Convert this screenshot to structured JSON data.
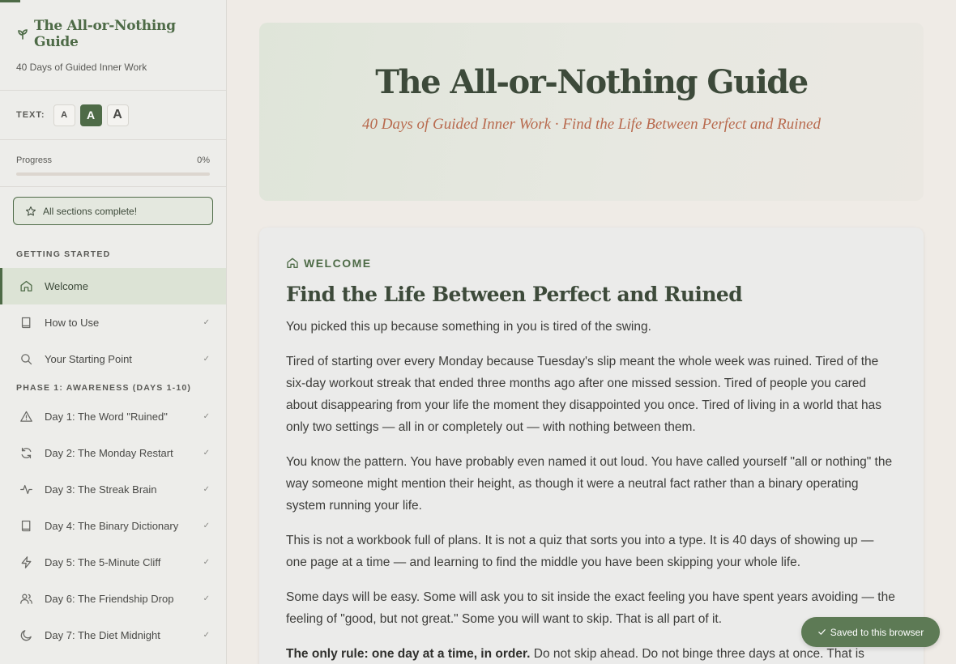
{
  "brand": {
    "title": "The All-or-Nothing Guide",
    "subtitle": "40 Days of Guided Inner Work"
  },
  "text_size": {
    "label": "TEXT:",
    "small": "A",
    "medium": "A",
    "large": "A",
    "selected": "medium"
  },
  "progress": {
    "label": "Progress",
    "value_text": "0%",
    "value": 0
  },
  "complete_badge": "All sections complete!",
  "nav": {
    "getting_started": {
      "title": "GETTING STARTED",
      "items": [
        {
          "label": "Welcome",
          "icon": "home-icon"
        },
        {
          "label": "How to Use",
          "icon": "book-icon",
          "check": "✓"
        },
        {
          "label": "Your Starting Point",
          "icon": "search-icon",
          "check": "✓"
        }
      ]
    },
    "phase1": {
      "title": "PHASE 1: AWARENESS (DAYS 1-10)",
      "items": [
        {
          "label": "Day 1: The Word \"Ruined\"",
          "icon": "warning-icon",
          "check": "✓"
        },
        {
          "label": "Day 2: The Monday Restart",
          "icon": "refresh-icon",
          "check": "✓"
        },
        {
          "label": "Day 3: The Streak Brain",
          "icon": "activity-icon",
          "check": "✓"
        },
        {
          "label": "Day 4: The Binary Dictionary",
          "icon": "book-icon",
          "check": "✓"
        },
        {
          "label": "Day 5: The 5-Minute Cliff",
          "icon": "lightning-icon",
          "check": "✓"
        },
        {
          "label": "Day 6: The Friendship Drop",
          "icon": "users-icon",
          "check": "✓"
        },
        {
          "label": "Day 7: The Diet Midnight",
          "icon": "moon-icon",
          "check": "✓"
        }
      ]
    }
  },
  "hero": {
    "title": "The All-or-Nothing Guide",
    "subtitle": "40 Days of Guided Inner Work · Find the Life Between Perfect and Ruined"
  },
  "card": {
    "eyebrow": "WELCOME",
    "title": "Find the Life Between Perfect and Ruined",
    "paragraphs": [
      "You picked this up because something in you is tired of the swing.",
      "Tired of starting over every Monday because Tuesday's slip meant the whole week was ruined. Tired of the six-day workout streak that ended three months ago after one missed session. Tired of people you cared about disappearing from your life the moment they disappointed you once. Tired of living in a world that has only two settings — all in or completely out — with nothing between them.",
      "You know the pattern. You have probably even named it out loud. You have called yourself \"all or nothing\" the way someone might mention their height, as though it were a neutral fact rather than a binary operating system running your life.",
      "This is not a workbook full of plans. It is not a quiz that sorts you into a type. It is 40 days of showing up — one page at a time — and learning to find the middle you have been skipping your whole life.",
      "Some days will be easy. Some will ask you to sit inside the exact feeling you have spent years avoiding — the feeling of \"good, but not great.\" Some you will want to skip. That is all part of it."
    ],
    "rule_bold": "The only rule: one day at a time, in order.",
    "rule_text": " Do not skip ahead. Do not binge three days at once. That is"
  },
  "toast": "Saved to this browser",
  "colors": {
    "accent": "#4e6b47",
    "terracotta": "#b86a4e",
    "background": "#efebe6"
  }
}
